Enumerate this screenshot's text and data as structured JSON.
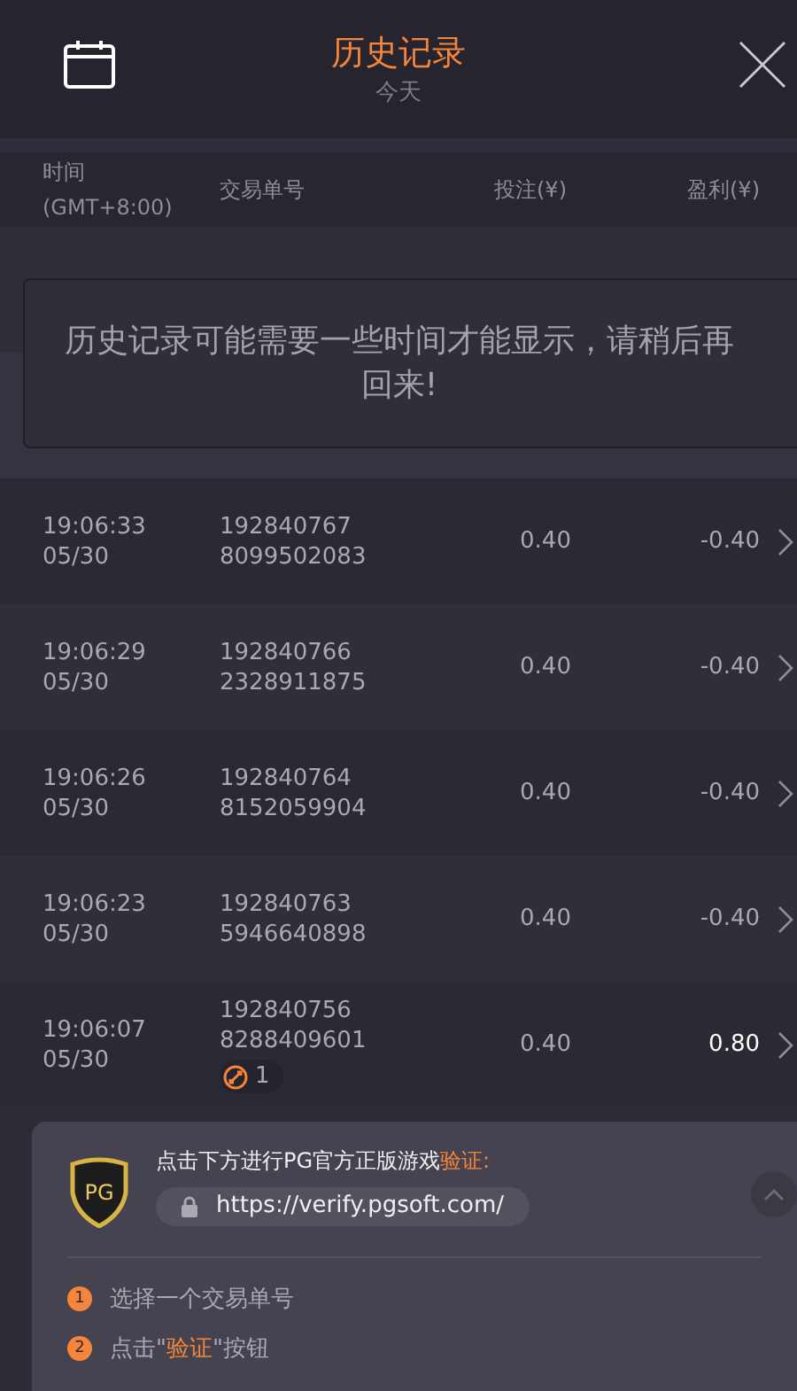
{
  "header": {
    "title": "历史记录",
    "subtitle": "今天"
  },
  "columns": [
    "时间",
    "(GMT+8:00)",
    "交易单号",
    "投注(¥)",
    "盈利(¥)"
  ],
  "toast": {
    "message": "历史记录可能需要一些时间才能显示，请稍后再回来!"
  },
  "rows": [
    {
      "time": "19:06:33",
      "date": "05/30",
      "order": "192840767",
      "order_suffix": "8099502083",
      "bet": "0.40",
      "profit": "-0.40",
      "win": false
    },
    {
      "time": "19:06:29",
      "date": "05/30",
      "order": "192840766",
      "order_suffix": "2328911875",
      "bet": "0.40",
      "profit": "-0.40",
      "win": false
    },
    {
      "time": "19:06:26",
      "date": "05/30",
      "order": "192840764",
      "order_suffix": "8152059904",
      "bet": "0.40",
      "profit": "-0.40",
      "win": false
    },
    {
      "time": "19:06:23",
      "date": "05/30",
      "order": "192840763",
      "order_suffix": "5946640898",
      "bet": "0.40",
      "profit": "-0.40",
      "win": false
    },
    {
      "time": "19:06:07",
      "date": "05/30",
      "order": "192840756",
      "order_suffix": "8288409601",
      "bet": "0.40",
      "profit": "0.80",
      "win": true,
      "badge": "1"
    }
  ],
  "verify": {
    "logo": "PG",
    "title_parts": [
      {
        "text": "点击下方进行PG官方正版游戏",
        "accent": false
      },
      {
        "text": "验证:",
        "accent": true
      }
    ],
    "url": "https://verify.pgsoft.com/",
    "steps": [
      {
        "number": "1",
        "parts": [
          {
            "text": "选择一个交易单号",
            "accent": false
          }
        ]
      },
      {
        "number": "2",
        "parts": [
          {
            "text": "点击\"",
            "accent": false
          },
          {
            "text": "验证",
            "accent": true
          },
          {
            "text": "\"按钮",
            "accent": false
          }
        ]
      }
    ]
  }
}
